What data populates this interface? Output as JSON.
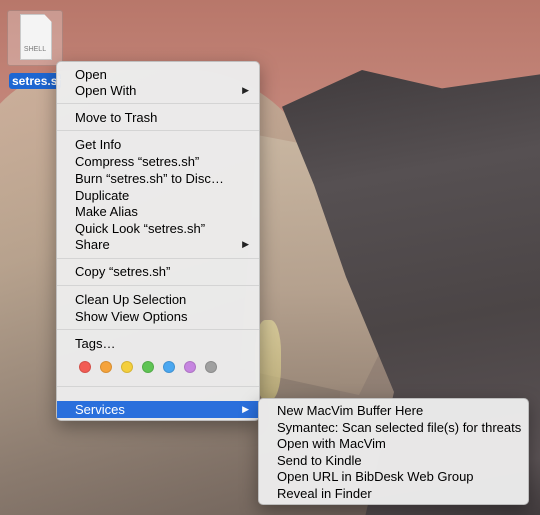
{
  "desktop_file": {
    "icon_label": "SHELL",
    "name": "setres.sh"
  },
  "context_menu": {
    "open": "Open",
    "open_with": "Open With",
    "move_to_trash": "Move to Trash",
    "get_info": "Get Info",
    "compress": "Compress “setres.sh”",
    "burn": "Burn “setres.sh” to Disc…",
    "duplicate": "Duplicate",
    "make_alias": "Make Alias",
    "quick_look": "Quick Look “setres.sh”",
    "share": "Share",
    "copy": "Copy “setres.sh”",
    "clean_up": "Clean Up Selection",
    "show_view_options": "Show View Options",
    "tags": "Tags…",
    "tag_colors": [
      "#f25c54",
      "#f5a33b",
      "#f4cf3d",
      "#5fc454",
      "#4aa7f0",
      "#c685e0",
      "#a0a0a0"
    ],
    "services": "Services",
    "arrow": "▶"
  },
  "services_menu": {
    "items": [
      "New MacVim Buffer Here",
      "Symantec: Scan selected file(s) for threats",
      "Open with MacVim",
      "Send to Kindle",
      "Open URL in BibDesk Web Group",
      "Reveal in Finder"
    ]
  },
  "colors": {
    "highlight": "#2a6fdc",
    "selection_label": "#1d66d2"
  }
}
